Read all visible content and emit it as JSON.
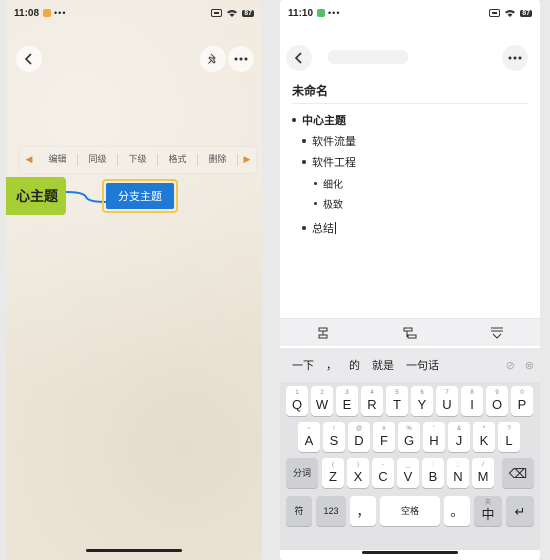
{
  "left_screen": {
    "status": {
      "time": "11:08",
      "dots": "•••",
      "battery": "87"
    },
    "toolbar": {
      "items": [
        "编辑",
        "同级",
        "下级",
        "格式",
        "删除"
      ]
    },
    "center_node": "心主题",
    "branch_node": "分支主题",
    "colors": {
      "center": "#a7cf35",
      "branch": "#1f7ad6",
      "branch_border": "#f2c94c",
      "toolbar_arrow": "#e88a2c"
    },
    "icons": {
      "back": "back-icon",
      "pin": "pin-icon",
      "more": "more-icon"
    }
  },
  "right_screen": {
    "status": {
      "time": "11:10",
      "dots": "•••",
      "battery": "87"
    },
    "doc_title": "未命名",
    "outline": [
      {
        "text": "中心主题",
        "level": 0
      },
      {
        "text": "软件流量",
        "level": 1
      },
      {
        "text": "软件工程",
        "level": 1
      },
      {
        "text": "细化",
        "level": 2
      },
      {
        "text": "极致",
        "level": 2
      },
      {
        "text": "总结",
        "level": 1
      }
    ],
    "candidates": [
      "一下",
      "，",
      "的",
      "就是",
      "一句话"
    ],
    "keyboard": {
      "row1": [
        {
          "main": "Q",
          "sub": "1"
        },
        {
          "main": "W",
          "sub": "2"
        },
        {
          "main": "E",
          "sub": "3"
        },
        {
          "main": "R",
          "sub": "4"
        },
        {
          "main": "T",
          "sub": "5"
        },
        {
          "main": "Y",
          "sub": "6"
        },
        {
          "main": "U",
          "sub": "7"
        },
        {
          "main": "I",
          "sub": "8"
        },
        {
          "main": "O",
          "sub": "9"
        },
        {
          "main": "P",
          "sub": "0"
        }
      ],
      "row2": [
        {
          "main": "A",
          "sub": "~"
        },
        {
          "main": "S",
          "sub": "!"
        },
        {
          "main": "D",
          "sub": "@"
        },
        {
          "main": "F",
          "sub": "#"
        },
        {
          "main": "G",
          "sub": "%"
        },
        {
          "main": "H",
          "sub": "'"
        },
        {
          "main": "J",
          "sub": "&"
        },
        {
          "main": "K",
          "sub": "*"
        },
        {
          "main": "L",
          "sub": "?"
        }
      ],
      "row3": [
        {
          "main": "Z",
          "sub": "("
        },
        {
          "main": "X",
          "sub": ")"
        },
        {
          "main": "C",
          "sub": "-"
        },
        {
          "main": "V",
          "sub": "_"
        },
        {
          "main": "B",
          "sub": ":"
        },
        {
          "main": "N",
          "sub": ";"
        },
        {
          "main": "M",
          "sub": "/"
        }
      ],
      "segment_key": "分词",
      "delete_key": "⌫",
      "symbol_key": "符",
      "num_key": "123",
      "comma_key": "，",
      "space_key": "空格",
      "period_key": "。",
      "lang_key": "中",
      "lang_sub": "英",
      "enter_key": "↵"
    }
  }
}
